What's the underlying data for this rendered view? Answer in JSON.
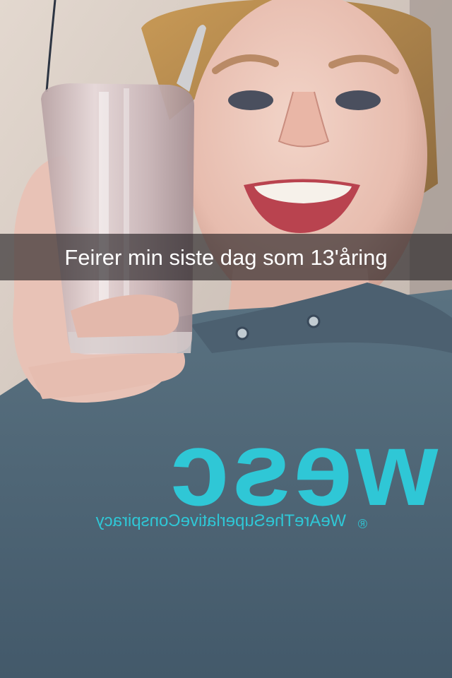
{
  "snap": {
    "caption": "Feirer min siste dag som 13'åring",
    "photo": {
      "subject": "selfie-photo",
      "hoodie_logo": "wesc",
      "hoodie_tagline": "WeAreTheSuperlativeConspiracy",
      "hoodie_mark": "®"
    }
  },
  "colors": {
    "caption_bar": "#1e1c1e",
    "caption_text": "#ffffff",
    "hoodie": "#4f6573",
    "logo": "#2fc7d6",
    "wall": "#d9cfc6"
  }
}
